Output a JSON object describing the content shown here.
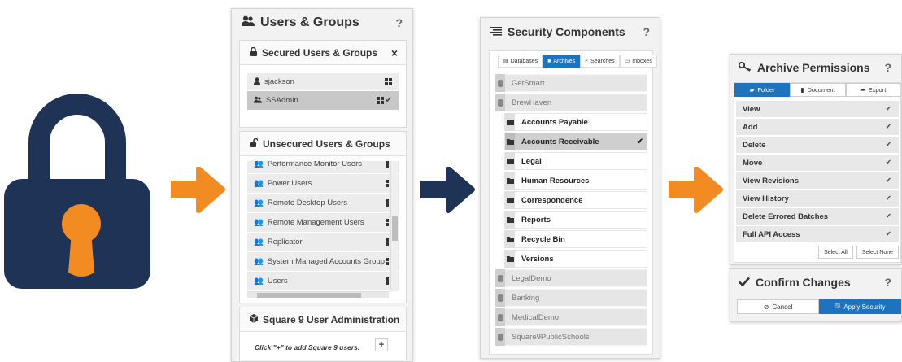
{
  "colors": {
    "navy": "#1f3357",
    "orange": "#f28b21",
    "accent_blue": "#1e73be"
  },
  "users_groups": {
    "title": "Users & Groups",
    "help": "?",
    "secured": {
      "title": "Secured Users & Groups",
      "close": "×",
      "items": [
        {
          "label": "sjackson",
          "icon": "user-icon"
        },
        {
          "label": "SSAdmin",
          "icon": "group-icon",
          "selected": true
        }
      ]
    },
    "unsecured": {
      "title": "Unsecured Users & Groups",
      "items": [
        {
          "label": "Performance Monitor Users"
        },
        {
          "label": "Power Users"
        },
        {
          "label": "Remote Desktop Users"
        },
        {
          "label": "Remote Management Users"
        },
        {
          "label": "Replicator"
        },
        {
          "label": "System Managed Accounts Group"
        },
        {
          "label": "Users"
        }
      ]
    },
    "admin": {
      "title": "Square 9 User Administration",
      "hint": "Click \"+\" to add Square 9 users.",
      "add": "+"
    }
  },
  "security_components": {
    "title": "Security Components",
    "help": "?",
    "tabs": [
      {
        "label": "Databases",
        "active": false
      },
      {
        "label": "Archives",
        "active": true
      },
      {
        "label": "Searches",
        "active": false
      },
      {
        "label": "Inboxes",
        "active": false
      }
    ],
    "tree": [
      {
        "label": "GetSmart",
        "type": "database"
      },
      {
        "label": "BrewHaven",
        "type": "database"
      },
      {
        "label": "Accounts Payable",
        "type": "archive"
      },
      {
        "label": "Accounts Receivable",
        "type": "archive",
        "selected": true
      },
      {
        "label": "Legal",
        "type": "archive"
      },
      {
        "label": "Human Resources",
        "type": "archive"
      },
      {
        "label": "Correspondence",
        "type": "archive"
      },
      {
        "label": "Reports",
        "type": "archive"
      },
      {
        "label": "Recycle Bin",
        "type": "archive"
      },
      {
        "label": "Versions",
        "type": "archive"
      },
      {
        "label": "LegalDemo",
        "type": "database"
      },
      {
        "label": "Banking",
        "type": "database"
      },
      {
        "label": "MedicalDemo",
        "type": "database"
      },
      {
        "label": "Square9PublicSchools",
        "type": "database"
      }
    ]
  },
  "archive_permissions": {
    "title": "Archive Permissions",
    "help": "?",
    "tabs": [
      {
        "label": "Folder",
        "active": true
      },
      {
        "label": "Document",
        "active": false
      },
      {
        "label": "Export",
        "active": false
      }
    ],
    "permissions": [
      {
        "label": "View",
        "checked": true
      },
      {
        "label": "Add",
        "checked": true
      },
      {
        "label": "Delete",
        "checked": true
      },
      {
        "label": "Move",
        "checked": true
      },
      {
        "label": "View Revisions",
        "checked": true
      },
      {
        "label": "View History",
        "checked": true
      },
      {
        "label": "Delete Errored Batches",
        "checked": true
      },
      {
        "label": "Full API Access",
        "checked": true
      }
    ],
    "select_all": "Select All",
    "select_none": "Select None"
  },
  "confirm": {
    "title": "Confirm Changes",
    "help": "?",
    "cancel": "Cancel",
    "apply": "Apply Security"
  }
}
